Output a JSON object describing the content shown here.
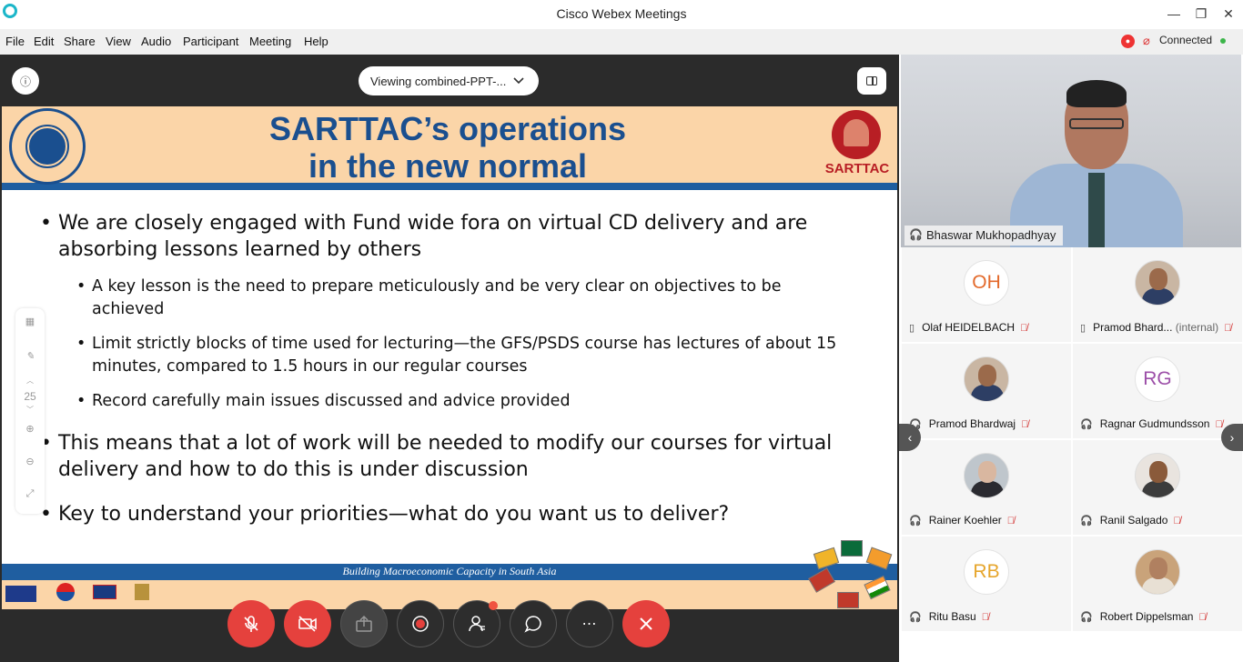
{
  "window": {
    "title": "Cisco Webex Meetings",
    "minimize": "—",
    "restore": "❐",
    "close": "✕"
  },
  "menu": [
    "File",
    "Edit",
    "Share",
    "View",
    "Audio",
    "Participant",
    "Meeting",
    "Help"
  ],
  "status": {
    "connected": "Connected"
  },
  "share": {
    "viewing": "Viewing combined-PPT-...",
    "page_number": "25"
  },
  "slide": {
    "title_line1": "SARTTAC’s operations",
    "title_line2": "in the new normal",
    "logo_word": "SARTTAC",
    "bullets": [
      "We are closely engaged with Fund wide fora on virtual CD delivery and are absorbing lessons learned by others",
      "A key lesson is the need to prepare meticulously and be very clear on objectives to be achieved",
      "Limit strictly blocks of time used for lecturing—the GFS/PSDS course has lectures of about 15 minutes, compared to 1.5 hours in our regular courses",
      "Record carefully main issues discussed and advice provided",
      "This means that a lot of work will be needed to modify our courses for virtual delivery and how to do this is under discussion",
      "Key to understand your priorities—what do you want us to deliver?"
    ],
    "footer": "Building Macroeconomic Capacity in South Asia"
  },
  "active_speaker": {
    "name": "Bhaswar Mukhopadhyay"
  },
  "participants": [
    {
      "name": "Olaf HEIDELBACH",
      "initials": "OH",
      "initials_color": "#e36a2c"
    },
    {
      "name": "Pramod Bhard...",
      "suffix": "(internal)"
    },
    {
      "name": "Pramod Bhardwaj"
    },
    {
      "name": "Ragnar Gudmundsson",
      "initials": "RG",
      "initials_color": "#9c4fa8"
    },
    {
      "name": "Rainer Koehler"
    },
    {
      "name": "Ranil Salgado"
    },
    {
      "name": "Ritu Basu",
      "initials": "RB",
      "initials_color": "#e6a52b"
    },
    {
      "name": "Robert Dippelsman"
    }
  ]
}
